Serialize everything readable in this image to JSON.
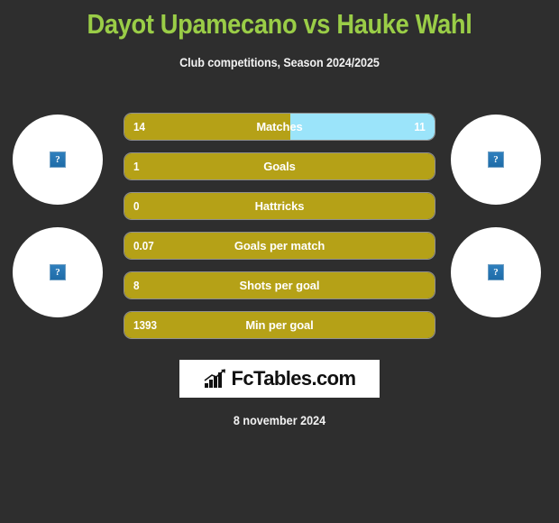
{
  "header": {
    "title": "Dayot Upamecano vs Hauke Wahl",
    "subtitle": "Club competitions, Season 2024/2025",
    "title_color": "#9ACD47"
  },
  "players": {
    "home": {
      "name": "Dayot Upamecano",
      "avatar_icon": "broken-image-placeholder",
      "avatar_glyph": "?"
    },
    "away": {
      "name": "Hauke Wahl",
      "avatar_icon": "broken-image-placeholder",
      "avatar_glyph": "?"
    }
  },
  "colors": {
    "background": "#2e2e2e",
    "home_bar": "#B5A117",
    "away_bar": "#9BE4FA",
    "text": "#ffffff"
  },
  "chart_data": {
    "type": "bar",
    "title": "Dayot Upamecano vs Hauke Wahl",
    "subtitle": "Club competitions, Season 2024/2025",
    "orientation": "horizontal-diverging",
    "legend": [
      "Dayot Upamecano",
      "Hauke Wahl"
    ],
    "categories": [
      "Matches",
      "Goals",
      "Hattricks",
      "Goals per match",
      "Shots per goal",
      "Min per goal"
    ],
    "series": [
      {
        "name": "Dayot Upamecano",
        "color": "#B5A117",
        "values": [
          "14",
          "1",
          "0",
          "0.07",
          "8",
          "1393"
        ]
      },
      {
        "name": "Hauke Wahl",
        "color": "#9BE4FA",
        "values": [
          "11",
          "",
          "",
          "",
          "",
          ""
        ]
      }
    ],
    "rows": [
      {
        "label": "Matches",
        "left_value": "14",
        "right_value": "11",
        "left_pct": 53.5,
        "right_pct": 46.5
      },
      {
        "label": "Goals",
        "left_value": "1",
        "right_value": "",
        "left_pct": 100,
        "right_pct": 0
      },
      {
        "label": "Hattricks",
        "left_value": "0",
        "right_value": "",
        "left_pct": 100,
        "right_pct": 0
      },
      {
        "label": "Goals per match",
        "left_value": "0.07",
        "right_value": "",
        "left_pct": 100,
        "right_pct": 0
      },
      {
        "label": "Shots per goal",
        "left_value": "8",
        "right_value": "",
        "left_pct": 100,
        "right_pct": 0
      },
      {
        "label": "Min per goal",
        "left_value": "1393",
        "right_value": "",
        "left_pct": 100,
        "right_pct": 0
      }
    ]
  },
  "logo": {
    "text": "FcTables.com",
    "icon": "bar-chart-growth-icon"
  },
  "footer": {
    "date": "8 november 2024"
  }
}
